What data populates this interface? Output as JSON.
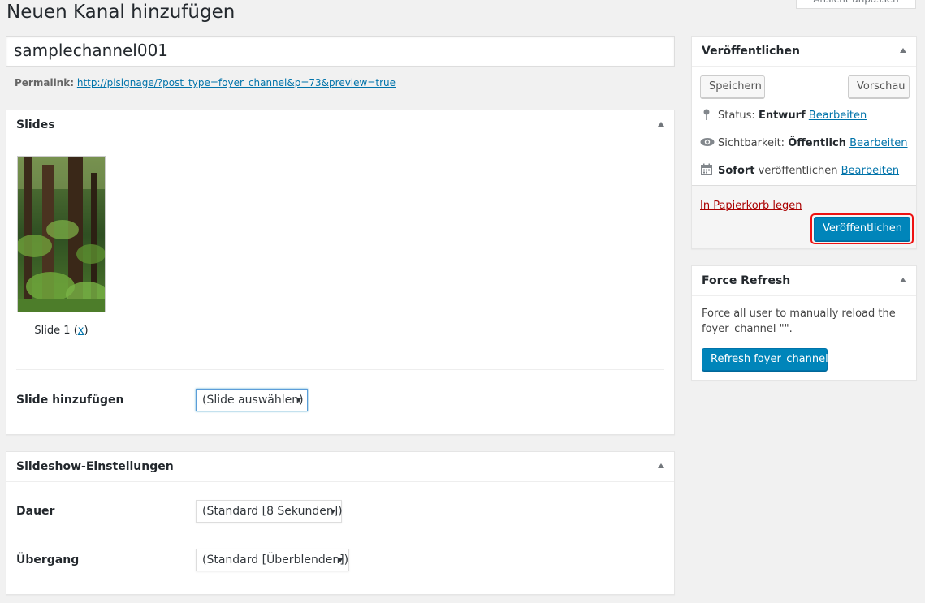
{
  "page": {
    "title": "Neuen Kanal hinzufügen",
    "screen_options_label": "Ansicht anpassen"
  },
  "post": {
    "title_value": "samplechannel001",
    "permalink_label": "Permalink:",
    "permalink_url": "http://pisignage/?post_type=foyer_channel&p=73&preview=true"
  },
  "slides_box": {
    "heading": "Slides",
    "slides": [
      {
        "caption": "Slide 1",
        "remove_label": "x"
      }
    ],
    "add_slide_label": "Slide hinzufügen",
    "add_slide_select": "(Slide auswählen)"
  },
  "settings_box": {
    "heading": "Slideshow-Einstellungen",
    "duration_label": "Dauer",
    "duration_select": "(Standard [8 Sekunden])",
    "transition_label": "Übergang",
    "transition_select": "(Standard [Überblenden])"
  },
  "publish_box": {
    "heading": "Veröffentlichen",
    "save_label": "Speichern",
    "preview_label": "Vorschau",
    "status_label": "Status:",
    "status_value": "Entwurf",
    "visibility_label": "Sichtbarkeit:",
    "visibility_value": "Öffentlich",
    "schedule_value": "Sofort",
    "schedule_label": "veröffentlichen",
    "edit_label": "Bearbeiten",
    "trash_label": "In Papierkorb legen",
    "publish_label": "Veröffentlichen"
  },
  "refresh_box": {
    "heading": "Force Refresh",
    "description": "Force all user to manually reload the foyer_channel \"\".",
    "button_label": "Refresh foyer_channel"
  },
  "colors": {
    "primary": "#0085ba",
    "link": "#0073aa",
    "trash": "#aa0000",
    "highlight": "#ee1111",
    "background": "#f1f1f1"
  }
}
